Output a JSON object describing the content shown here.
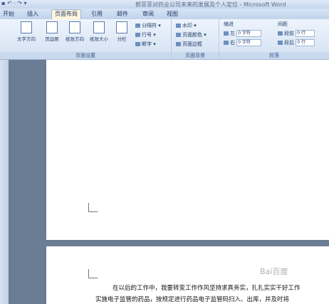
{
  "window": {
    "title": "郭菲菲对药业公司未来的发展及个人定位 - Microsoft Word",
    "qat": "▪ ↶ · ↷ ▾"
  },
  "tabs": [
    {
      "label": "开始",
      "active": false
    },
    {
      "label": "插入",
      "active": false
    },
    {
      "label": "页面布局",
      "active": true
    },
    {
      "label": "引用",
      "active": false
    },
    {
      "label": "邮件",
      "active": false
    },
    {
      "label": "审阅",
      "active": false
    },
    {
      "label": "视图",
      "active": false
    }
  ],
  "ribbon": {
    "page_setup": {
      "label": "页面设置",
      "text_direction": "文字方向",
      "margins": "页边距",
      "orientation": "纸张方向",
      "size": "纸张大小",
      "columns": "分栏",
      "breaks": "分隔符 ▾",
      "line_numbers": "行号 ▾",
      "hyphenation": "断字 ▾"
    },
    "page_background": {
      "label": "页面背景",
      "watermark": "水印 ▾",
      "page_color": "页面颜色 ▾",
      "page_borders": "页面边框"
    },
    "paragraph": {
      "label": "段落",
      "indent_title": "缩进",
      "indent_left_label": "左",
      "indent_left_value": "0 字符",
      "indent_right_label": "右",
      "indent_right_value": "0 字符",
      "spacing_title": "间距",
      "spacing_before_label": "段前",
      "spacing_before_value": "0 行",
      "spacing_after_label": "段后",
      "spacing_after_value": "0 行"
    }
  },
  "document": {
    "line1": "在以后的工作中，我要转变工作作风坚持求真务实，扎扎实实干好工作",
    "line2": "实施电子监管的药品，按规定进行药品电子监管码扫入、出库，并及时将",
    "watermark": "Bai百度"
  }
}
